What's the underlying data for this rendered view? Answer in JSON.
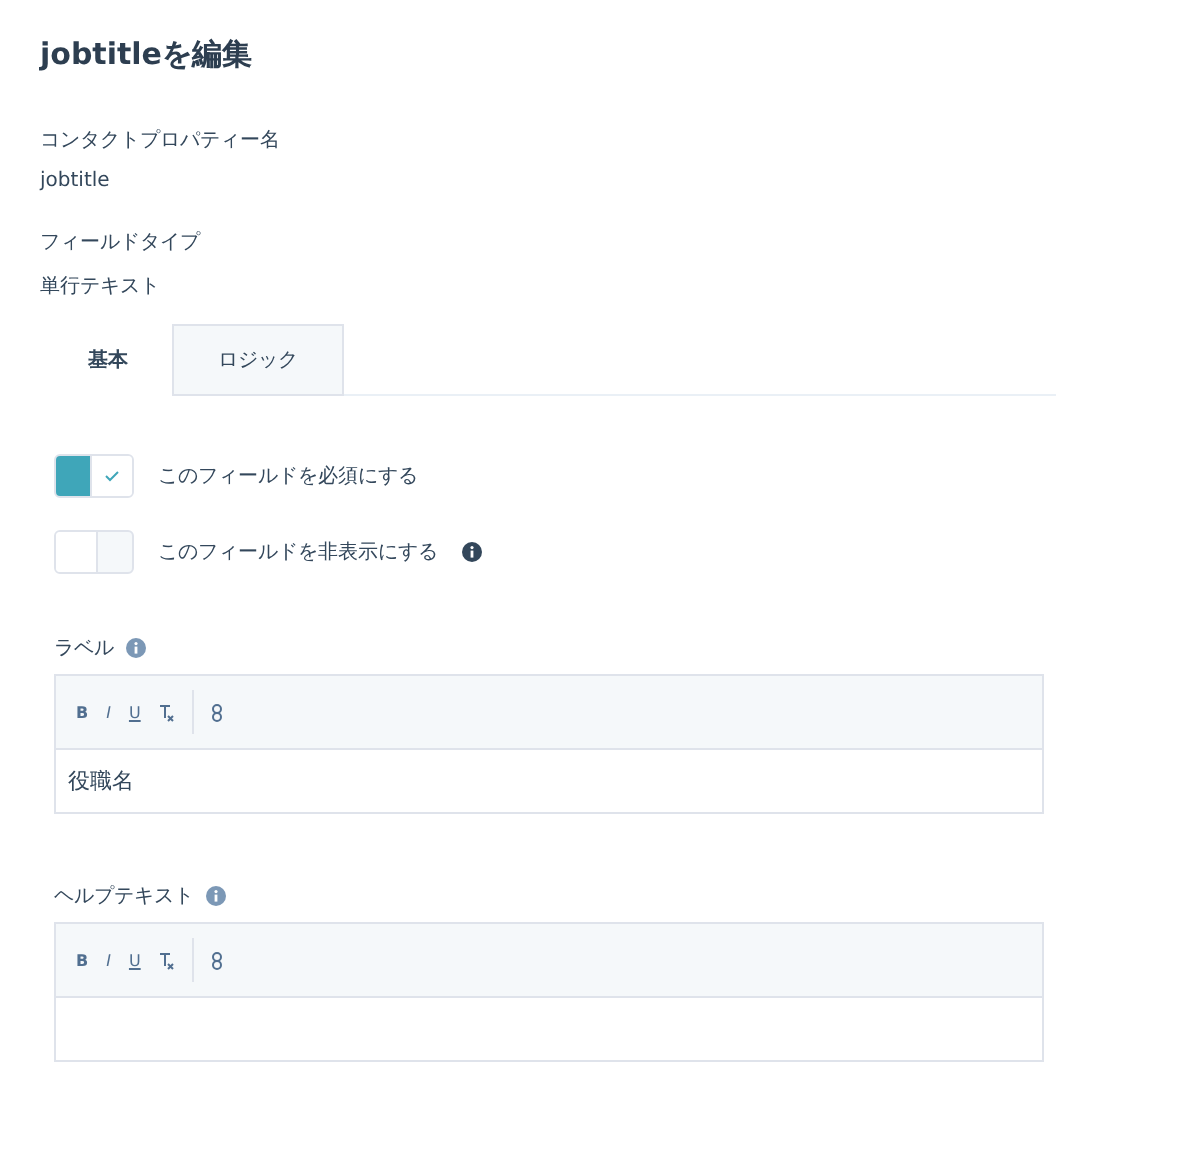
{
  "title": "jobtitleを編集",
  "fields": [
    {
      "label": "コンタクトプロパティー名",
      "value": "jobtitle"
    },
    {
      "label": "フィールドタイプ",
      "value": "単行テキスト"
    }
  ],
  "tabs": [
    {
      "label": "基本",
      "selected": true
    },
    {
      "label": "ロジック",
      "selected": false
    }
  ],
  "toggles": [
    {
      "label": "このフィールドを必須にする",
      "on": true,
      "info": false
    },
    {
      "label": "このフィールドを非表示にする",
      "on": false,
      "info": true
    }
  ],
  "editors": [
    {
      "label": "ラベル",
      "toolbar": [
        "B",
        "I",
        "U"
      ],
      "value": "役職名"
    },
    {
      "label": "ヘルプテキスト",
      "toolbar": [
        "B",
        "I",
        "U"
      ]
    }
  ]
}
